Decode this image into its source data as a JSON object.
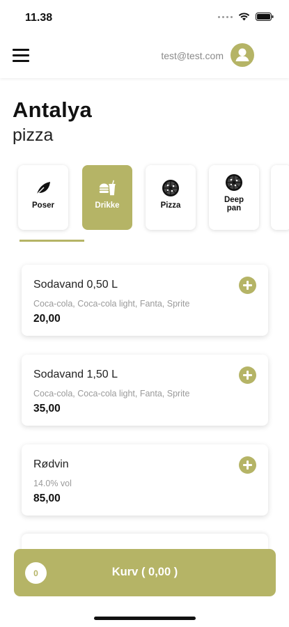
{
  "status_bar": {
    "time": "11.38",
    "icons": [
      "signal-dots-icon",
      "wifi-icon",
      "battery-icon"
    ]
  },
  "header": {
    "menu_icon": "hamburger-menu-icon",
    "user_email": "test@test.com",
    "avatar_icon": "user-avatar-icon"
  },
  "restaurant": {
    "name": "Antalya",
    "subtitle": "pizza"
  },
  "categories": [
    {
      "label": "Poser",
      "icon": "leaf-icon",
      "active": false
    },
    {
      "label": "Drikke",
      "icon": "burger-drink-icon",
      "active": true
    },
    {
      "label": "Pizza",
      "icon": "pizza-icon",
      "active": false
    },
    {
      "label": "Deep pan",
      "icon": "pizza-icon",
      "active": false
    }
  ],
  "products": [
    {
      "name": "Sodavand 0,50 L",
      "description": "Coca-cola, Coca-cola light, Fanta, Sprite",
      "price": "20,00"
    },
    {
      "name": "Sodavand 1,50 L",
      "description": "Coca-cola, Coca-cola light, Fanta, Sprite",
      "price": "35,00"
    },
    {
      "name": "Rødvin",
      "description": "14.0% vol",
      "price": "85,00"
    }
  ],
  "cart": {
    "count": "0",
    "label": "Kurv ( 0,00 )"
  },
  "colors": {
    "accent": "#b5b466",
    "text": "#111111",
    "muted": "#9a9a9a"
  }
}
